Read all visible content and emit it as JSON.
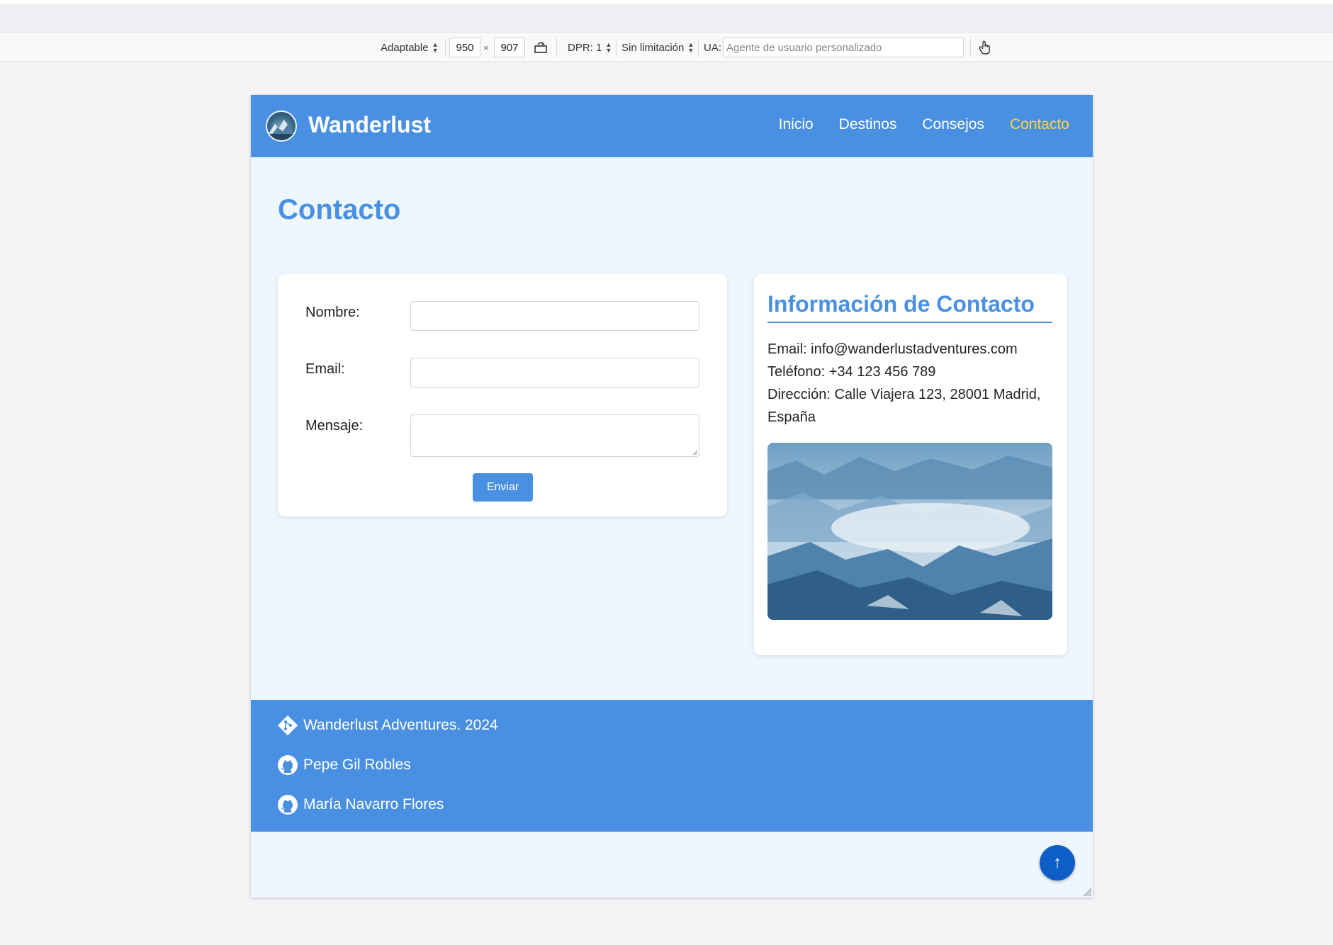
{
  "devtools": {
    "device_label": "Adaptable",
    "width_value": "950",
    "times": "×",
    "height_value": "907",
    "dpr_label": "DPR: 1",
    "throttle_label": "Sin limitación",
    "ua_label": "UA:",
    "ua_placeholder": "Agente de usuario personalizado",
    "icons": [
      "rotate-icon",
      "touch-simulation-icon"
    ]
  },
  "site": {
    "brand": "Wanderlust",
    "nav": [
      {
        "label": "Inicio"
      },
      {
        "label": "Destinos"
      },
      {
        "label": "Consejos"
      },
      {
        "label": "Contacto",
        "active": true
      }
    ],
    "page_title": "Contacto",
    "form": {
      "name_label": "Nombre:",
      "name_value": "",
      "email_label": "Email:",
      "email_value": "",
      "message_label": "Mensaje:",
      "message_value": "",
      "submit_label": "Enviar"
    },
    "info": {
      "title": "Información de Contacto",
      "email": "Email: info@wanderlustadventures.com",
      "phone": "Teléfono: +34 123 456 789",
      "address": "Dirección: Calle Viajera 123, 28001 Madrid, España"
    },
    "footer": {
      "copyright": "Wanderlust Adventures. 2024",
      "authors": [
        "Pepe Gil Robles",
        "María Navarro Flores"
      ]
    },
    "back_to_top": "↑"
  },
  "colors": {
    "primary": "#4a90e2",
    "active_nav": "#ffd43b",
    "page_bg": "#eef6fe",
    "back_to_top": "#0d5fc7"
  }
}
